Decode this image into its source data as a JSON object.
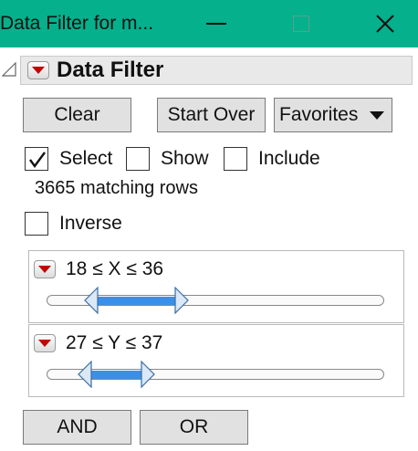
{
  "window": {
    "title": "Data Filter for m...",
    "minimize_icon": "minimize-icon",
    "maximize_icon": "maximize-icon",
    "close_icon": "close-icon",
    "accent_color": "#05b08c"
  },
  "header": {
    "title": "Data Filter",
    "menu_icon": "red-triangle-menu-icon"
  },
  "buttons": {
    "clear": "Clear",
    "start_over": "Start Over",
    "favorites": "Favorites",
    "and": "AND",
    "or": "OR"
  },
  "modes": {
    "select": {
      "label": "Select",
      "checked": true
    },
    "show": {
      "label": "Show",
      "checked": false
    },
    "include": {
      "label": "Include",
      "checked": false
    }
  },
  "matching_rows": "3665 matching rows",
  "inverse": {
    "label": "Inverse",
    "checked": false
  },
  "filters": [
    {
      "label": "18 ≤ X ≤ 36",
      "selected_start_fraction": 0.15,
      "selected_end_fraction": 0.38
    },
    {
      "label": "27 ≤ Y ≤ 37",
      "selected_start_fraction": 0.13,
      "selected_end_fraction": 0.28
    }
  ],
  "colors": {
    "slider_fill": "#3d8fe6",
    "menu_triangle": "#c40000"
  }
}
